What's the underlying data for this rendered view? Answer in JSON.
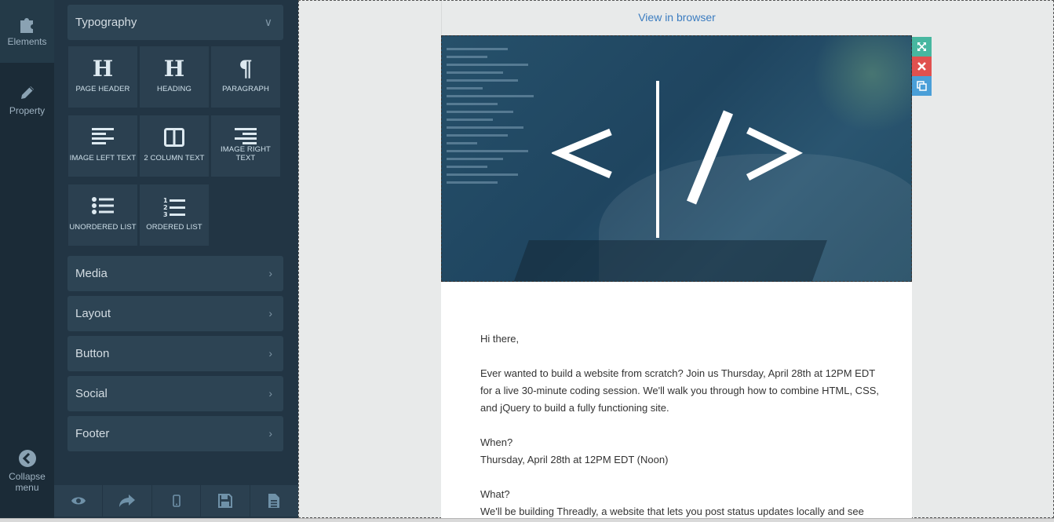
{
  "rail": {
    "elements_label": "Elements",
    "property_label": "Property",
    "collapse_label_1": "Collapse",
    "collapse_label_2": "menu"
  },
  "panel": {
    "typography_label": "Typography",
    "tiles": [
      {
        "label": "PAGE HEADER",
        "glyph": "H"
      },
      {
        "label": "HEADING",
        "glyph": "H"
      },
      {
        "label": "PARAGRAPH",
        "glyph": "¶"
      },
      {
        "label": "IMAGE LEFT TEXT"
      },
      {
        "label": "2 COLUMN TEXT"
      },
      {
        "label": "IMAGE RIGHT TEXT"
      },
      {
        "label": "UNORDERED LIST"
      },
      {
        "label": "ORDERED LIST"
      }
    ],
    "sections": [
      {
        "label": "Media"
      },
      {
        "label": "Layout"
      },
      {
        "label": "Button"
      },
      {
        "label": "Social"
      },
      {
        "label": "Footer"
      }
    ],
    "bottom_icons": [
      "eye-icon",
      "share-icon",
      "mobile-icon",
      "save-icon",
      "document-icon"
    ]
  },
  "email": {
    "view_in_browser": "View in browser",
    "greeting": "Hi there,",
    "intro": "Ever wanted to build a website from scratch? Join us Thursday, April 28th at 12PM EDT for a live 30-minute coding session. We'll walk you through how to combine HTML, CSS, and jQuery to build a fully functioning site.",
    "when_q": "When?",
    "when_a": "Thursday, April 28th at 12PM EDT (Noon)",
    "what_q": "What?",
    "what_a": "We'll be building Threadly, a website that lets you post status updates locally and see"
  },
  "colors": {
    "rail_bg": "#1b2b37",
    "panel_bg": "#223544",
    "tile_bg": "#2b4050",
    "link": "#3b7cc0",
    "tool_full": "#47b7a0",
    "tool_delete": "#e0514f",
    "tool_copy": "#4a9fd8"
  }
}
